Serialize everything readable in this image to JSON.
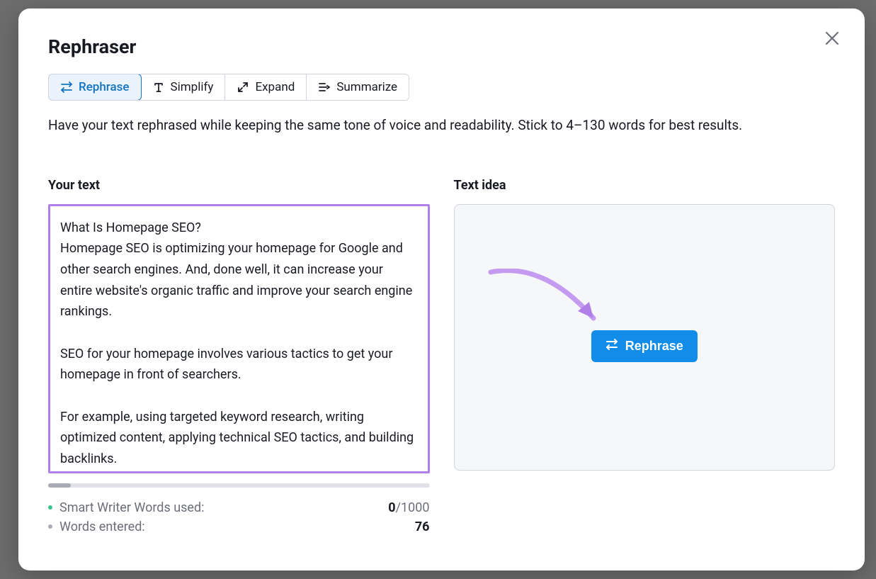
{
  "modal": {
    "title": "Rephraser",
    "description": "Have your text rephrased while keeping the same tone of voice and readability. Stick to 4–130 words for best results."
  },
  "tabs": {
    "rephrase": "Rephrase",
    "simplify": "Simplify",
    "expand": "Expand",
    "summarize": "Summarize"
  },
  "leftColumn": {
    "label": "Your text",
    "text": "What Is Homepage SEO?\nHomepage SEO is optimizing your homepage for Google and other search engines. And, done well, it can increase your entire website's organic traffic and improve your search engine rankings.\n\nSEO for your homepage involves various tactics to get your homepage in front of searchers.\n\nFor example, using targeted keyword research, writing optimized content, applying technical SEO tactics, and building backlinks."
  },
  "rightColumn": {
    "label": "Text idea",
    "buttonLabel": "Rephrase"
  },
  "stats": {
    "smartWriterLabel": "Smart Writer Words used:",
    "smartWriterUsed": "0",
    "smartWriterLimit": "/1000",
    "wordsEnteredLabel": "Words entered:",
    "wordsEnteredValue": "76"
  }
}
